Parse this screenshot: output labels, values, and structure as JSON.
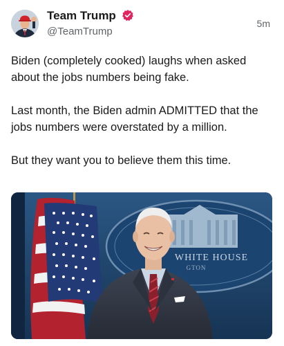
{
  "post": {
    "display_name": "Team Trump",
    "handle": "@TeamTrump",
    "timestamp": "5m",
    "paragraphs": [
      "Biden (completely cooked) laughs when asked about the jobs numbers being fake.",
      "Last month, the Biden admin ADMITTED that the jobs numbers were overstated by a million.",
      "But they want you to believe them this time."
    ],
    "media": {
      "seal_text_top": "WHITE HOUSE",
      "seal_text_bottom": "GTON"
    }
  },
  "colors": {
    "verified_badge": "#e0245e",
    "text_primary": "#1a1a1a",
    "text_secondary": "#5f6368",
    "media_background": "#1b3f66"
  },
  "icons": {
    "verified": "verified-badge-icon",
    "avatar": "avatar-image"
  }
}
